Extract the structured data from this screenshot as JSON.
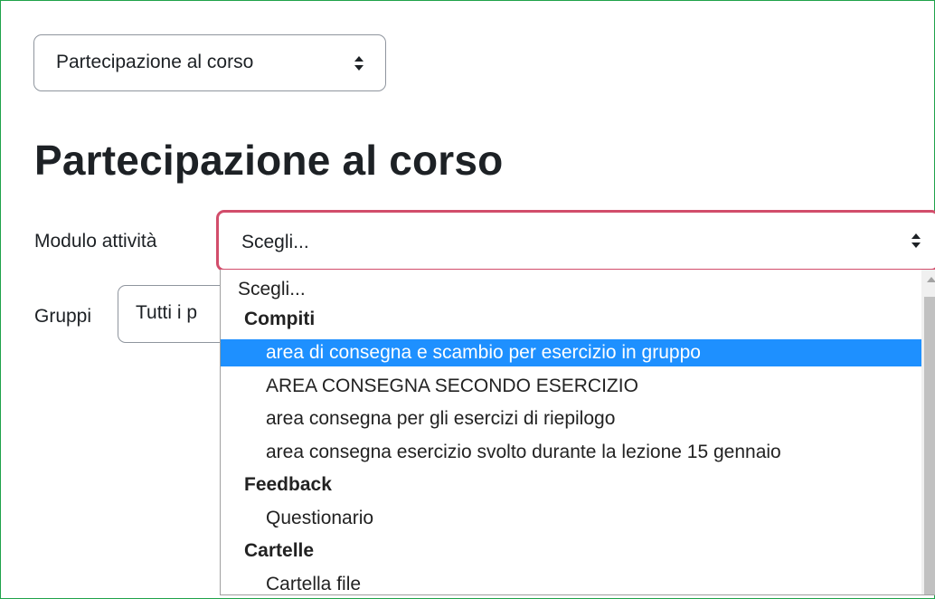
{
  "report_selector": {
    "value": "Partecipazione al corso"
  },
  "page_title": "Partecipazione al corso",
  "filters": {
    "module_label": "Modulo attività",
    "module_value": "Scegli...",
    "groups_label": "Gruppi",
    "groups_value": "Tutti i p"
  },
  "dropdown": {
    "options": [
      {
        "label": "Scegli...",
        "kind": "plain"
      },
      {
        "label": "Compiti",
        "kind": "group"
      },
      {
        "label": "area di consegna e scambio per esercizio in gruppo",
        "kind": "item",
        "selected": true
      },
      {
        "label": "AREA CONSEGNA SECONDO ESERCIZIO",
        "kind": "item"
      },
      {
        "label": "area consegna per gli esercizi di riepilogo",
        "kind": "item"
      },
      {
        "label": "area consegna esercizio svolto durante la lezione 15 gennaio",
        "kind": "item"
      },
      {
        "label": "Feedback",
        "kind": "group"
      },
      {
        "label": "Questionario",
        "kind": "item"
      },
      {
        "label": "Cartelle",
        "kind": "group"
      },
      {
        "label": "Cartella file",
        "kind": "item"
      }
    ]
  },
  "colors": {
    "frame_border": "#1fa34a",
    "focus_border": "#d24d6b",
    "selected_option": "#1e90ff"
  }
}
